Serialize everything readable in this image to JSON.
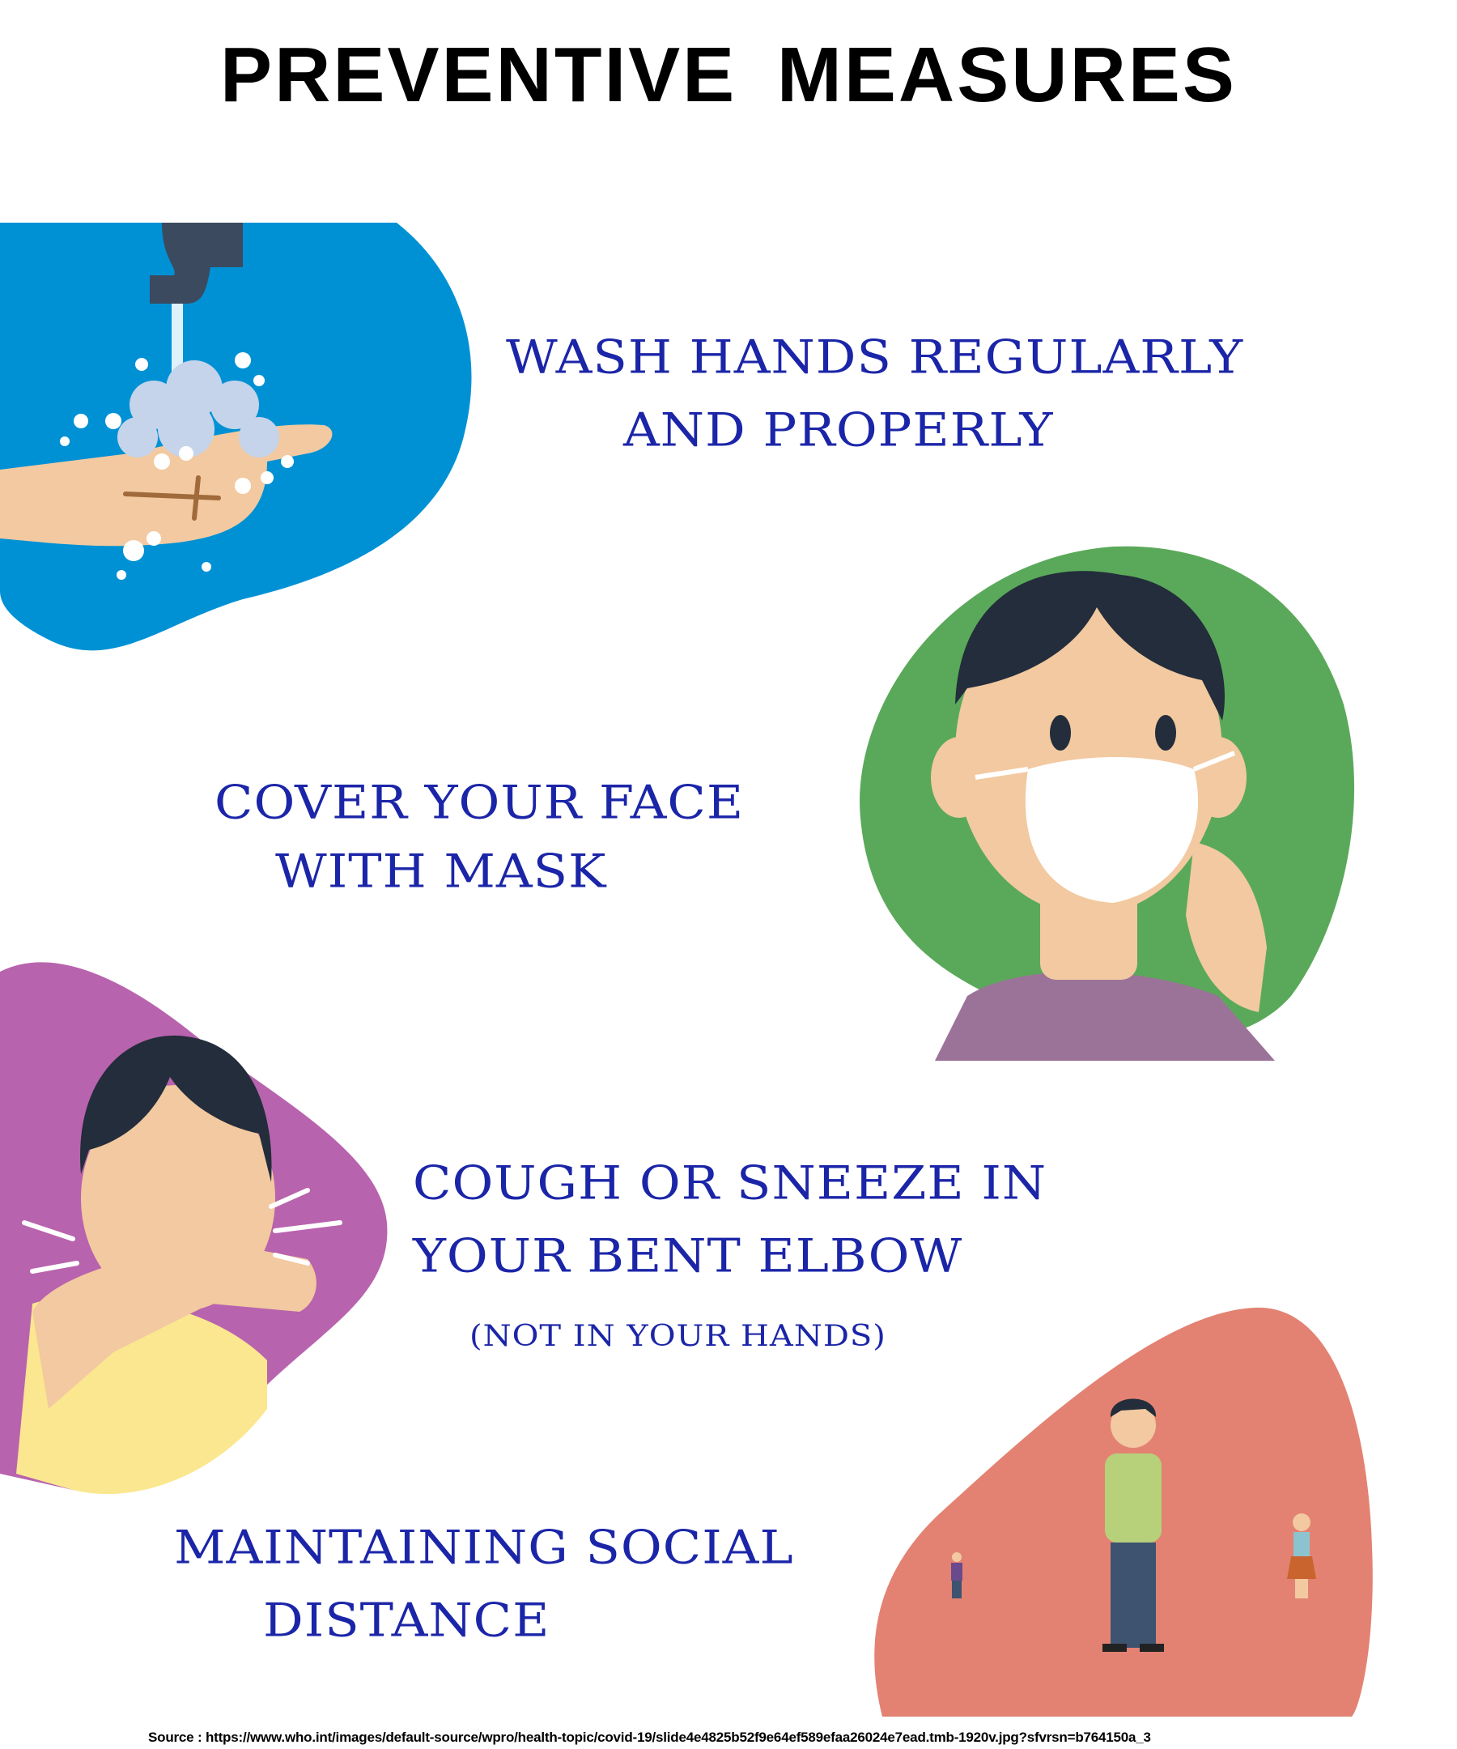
{
  "title": "PREVENTIVE  MEASURES",
  "measures": [
    {
      "line1": "WASH HANDS REGULARLY",
      "line2": "AND PROPERLY",
      "color": "#0091d5"
    },
    {
      "line1": "COVER YOUR FACE",
      "line2": "WITH MASK",
      "color": "#5aa95a"
    },
    {
      "line1": "COUGH OR SNEEZE IN",
      "line2": "YOUR BENT ELBOW",
      "note": "(NOT IN YOUR HANDS)",
      "color": "#b863ae"
    },
    {
      "line1": "MAINTAINING SOCIAL",
      "line2": "DISTANCE",
      "color": "#e38272"
    }
  ],
  "source": "Source : https://www.who.int/images/default-source/wpro/health-topic/covid-19/slide4e4825b52f9e64ef589efaa26024e7ead.tmb-1920v.jpg?sfvrsn=b764150a_3"
}
